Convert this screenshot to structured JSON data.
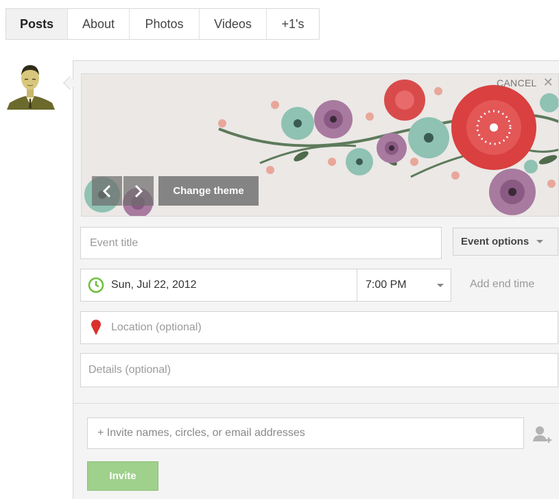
{
  "tabs": [
    {
      "label": "Posts",
      "active": true
    },
    {
      "label": "About",
      "active": false
    },
    {
      "label": "Photos",
      "active": false
    },
    {
      "label": "Videos",
      "active": false
    },
    {
      "label": "+1's",
      "active": false
    }
  ],
  "composer": {
    "cancel_label": "CANCEL",
    "close_icon": "close-icon",
    "change_theme_label": "Change theme",
    "prev_icon": "chevron-left-icon",
    "next_icon": "chevron-right-icon",
    "event_title_placeholder": "Event title",
    "event_options_label": "Event options",
    "date_value": "Sun, Jul 22, 2012",
    "time_value": "7:00 PM",
    "add_end_time_label": "Add end time",
    "location_placeholder": "Location (optional)",
    "details_placeholder": "Details (optional)",
    "invite_placeholder": "+ Invite names, circles, or email addresses",
    "invite_button_label": "Invite"
  },
  "colors": {
    "accent_green": "#9fd08c",
    "clock_green": "#6cbf3c",
    "pin_red": "#d9312b"
  }
}
